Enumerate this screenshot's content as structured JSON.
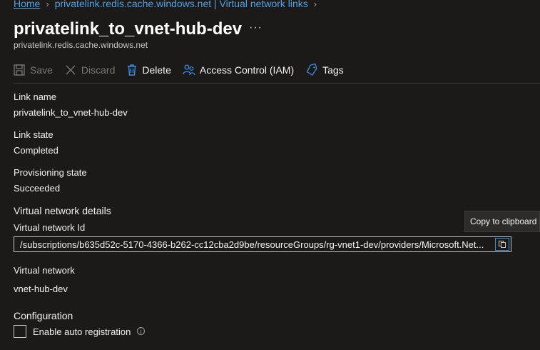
{
  "breadcrumb": {
    "home": "Home",
    "items": [
      "privatelink.redis.cache.windows.net | Virtual network links"
    ]
  },
  "page": {
    "title": "privatelink_to_vnet-hub-dev",
    "more": "···",
    "subtitle": "privatelink.redis.cache.windows.net"
  },
  "toolbar": {
    "save": "Save",
    "discard": "Discard",
    "delete": "Delete",
    "iam": "Access Control (IAM)",
    "tags": "Tags"
  },
  "fields": {
    "link_name_label": "Link name",
    "link_name_value": "privatelink_to_vnet-hub-dev",
    "link_state_label": "Link state",
    "link_state_value": "Completed",
    "provisioning_label": "Provisioning state",
    "provisioning_value": "Succeeded"
  },
  "vnet_details": {
    "heading": "Virtual network details",
    "id_label": "Virtual network Id",
    "id_value": "/subscriptions/b635d52c-5170-4366-b262-cc12cba2d9be/resourceGroups/rg-vnet1-dev/providers/Microsoft.Net...",
    "copy_tooltip": "Copy to clipboard",
    "network_label": "Virtual network",
    "network_link": "vnet-hub-dev"
  },
  "configuration": {
    "heading": "Configuration",
    "auto_registration_label": "Enable auto registration",
    "auto_registration_checked": false,
    "info": "i"
  },
  "colors": {
    "background": "#1b1a19",
    "link": "#4fa3e6",
    "accent": "#3a8ee6"
  }
}
